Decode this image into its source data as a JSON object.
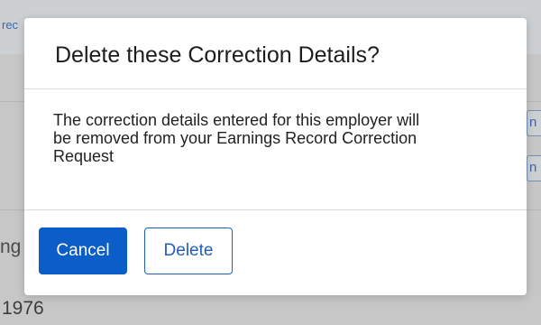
{
  "background": {
    "top_link_fragment": "rec",
    "left_fragment": "ng",
    "year_value": "1976",
    "right_button_1_fragment": "n",
    "right_button_2_fragment": "n"
  },
  "dialog": {
    "title": "Delete these Correction Details?",
    "body_line_1": "The correction details entered for this employer will",
    "body_line_2": "be removed from your Earnings Record Correction",
    "body_line_3": "Request",
    "cancel_label": "Cancel",
    "delete_label": "Delete"
  },
  "colors": {
    "primary_button": "#0b5dc7",
    "secondary_button_border": "#1f5fb8",
    "overlay_background": "#c7c7c7"
  }
}
